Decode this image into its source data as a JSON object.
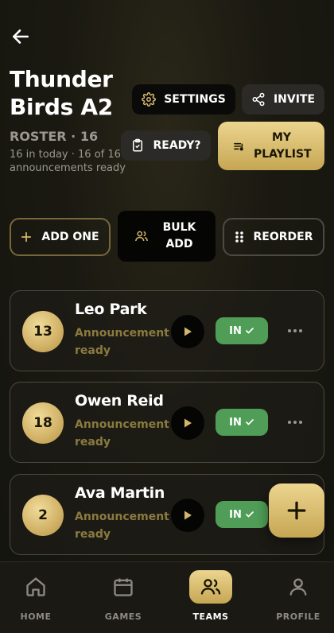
{
  "header": {
    "team_name": "Thunder Birds A2",
    "roster_label": "ROSTER · 16",
    "summary": "16 in today · 16 of 16 announcements ready"
  },
  "actions": {
    "settings": "SETTINGS",
    "invite": "INVITE",
    "ready": "READY?",
    "playlist": "MY PLAYLIST",
    "add_one": "ADD ONE",
    "bulk_add": "BULK ADD",
    "reorder": "REORDER"
  },
  "players": [
    {
      "number": "13",
      "name": "Leo Park",
      "status": "Announcement ready",
      "attendance": "IN"
    },
    {
      "number": "18",
      "name": "Owen Reid",
      "status": "Announcement ready",
      "attendance": "IN"
    },
    {
      "number": "2",
      "name": "Ava Martin",
      "status": "Announcement ready",
      "attendance": "IN"
    }
  ],
  "nav": [
    {
      "label": "HOME",
      "icon": "home-icon",
      "active": false
    },
    {
      "label": "GAMES",
      "icon": "calendar-icon",
      "active": false
    },
    {
      "label": "TEAMS",
      "icon": "teams-icon",
      "active": true
    },
    {
      "label": "PROFILE",
      "icon": "profile-icon",
      "active": false
    }
  ],
  "colors": {
    "accent_gold": "#d4b66a",
    "in_green": "#4f9d56",
    "background": "#1a1911"
  }
}
